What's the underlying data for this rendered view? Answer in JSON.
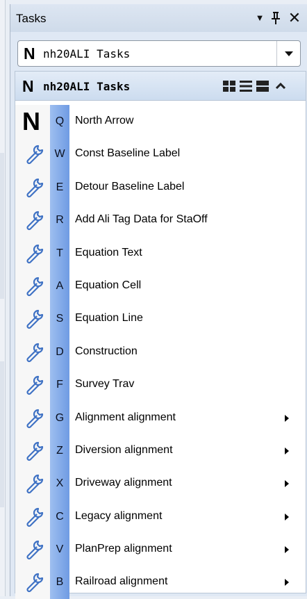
{
  "pane": {
    "title": "Tasks",
    "buttons": [
      {
        "name": "pane-options-button",
        "glyph": "▼"
      },
      {
        "name": "pane-pin-button",
        "glyph": "📌"
      },
      {
        "name": "pane-close-button",
        "glyph": "✕"
      }
    ]
  },
  "combo": {
    "logo": "N",
    "value": "nh20ALI Tasks"
  },
  "section": {
    "logo": "N",
    "title": "nh20ALI Tasks",
    "view_buttons": [
      "icon-view-icon",
      "list-view-icon",
      "detail-view-icon",
      "collapse-icon"
    ]
  },
  "tasks": [
    {
      "key": "Q",
      "label": "North Arrow",
      "icon": "n-logo-icon",
      "submenu": false
    },
    {
      "key": "W",
      "label": "Const Baseline Label",
      "icon": "wrench-icon",
      "submenu": false
    },
    {
      "key": "E",
      "label": "Detour Baseline Label",
      "icon": "wrench-icon",
      "submenu": false
    },
    {
      "key": "R",
      "label": "Add Ali Tag Data for StaOff",
      "icon": "wrench-icon",
      "submenu": false
    },
    {
      "key": "T",
      "label": "Equation Text",
      "icon": "wrench-icon",
      "submenu": false
    },
    {
      "key": "A",
      "label": "Equation Cell",
      "icon": "wrench-icon",
      "submenu": false
    },
    {
      "key": "S",
      "label": "Equation Line",
      "icon": "wrench-icon",
      "submenu": false
    },
    {
      "key": "D",
      "label": "Construction",
      "icon": "wrench-icon",
      "submenu": false
    },
    {
      "key": "F",
      "label": "Survey Trav",
      "icon": "wrench-icon",
      "submenu": false
    },
    {
      "key": "G",
      "label": "Alignment alignment",
      "icon": "wrench-icon",
      "submenu": true
    },
    {
      "key": "Z",
      "label": "Diversion alignment",
      "icon": "wrench-icon",
      "submenu": true
    },
    {
      "key": "X",
      "label": "Driveway alignment",
      "icon": "wrench-icon",
      "submenu": true
    },
    {
      "key": "C",
      "label": "Legacy alignment",
      "icon": "wrench-icon",
      "submenu": true
    },
    {
      "key": "V",
      "label": "PlanPrep alignment",
      "icon": "wrench-icon",
      "submenu": true
    },
    {
      "key": "B",
      "label": "Railroad alignment",
      "icon": "wrench-icon",
      "submenu": true
    }
  ],
  "colors": {
    "key_column": "#7fa6e8",
    "wrench": "#3f72c4",
    "panel_bg": "#dfe8f4"
  }
}
